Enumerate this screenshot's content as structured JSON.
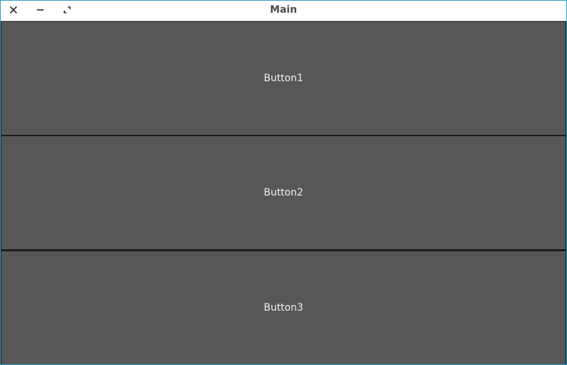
{
  "window": {
    "title": "Main",
    "controls": [
      {
        "icon": "close-icon"
      },
      {
        "icon": "minimize-icon"
      },
      {
        "icon": "maximize-icon"
      }
    ]
  },
  "buttons": [
    {
      "label": "Button1"
    },
    {
      "label": "Button2"
    },
    {
      "label": "Button3"
    }
  ],
  "colors": {
    "titlebar_bg": "#ffffff",
    "title_text": "#4a4a4a",
    "button_bg": "#575757",
    "button_text": "#f2f2f2",
    "separator": "#1b1b1b",
    "window_border": "#2aa1c9"
  }
}
